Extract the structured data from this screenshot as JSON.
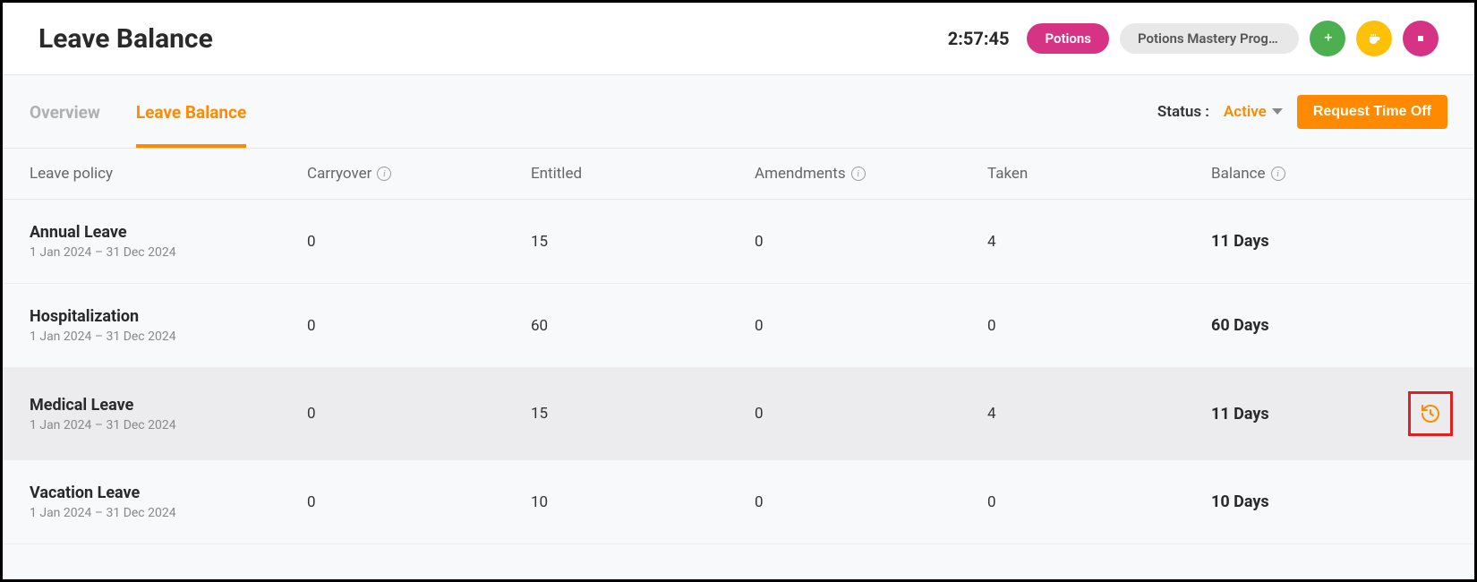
{
  "header": {
    "title": "Leave Balance",
    "timer": "2:57:45",
    "pill_primary": "Potions",
    "pill_secondary": "Potions Mastery Progr…"
  },
  "tabs": {
    "overview": "Overview",
    "leave_balance": "Leave Balance"
  },
  "status": {
    "label": "Status :",
    "value": "Active"
  },
  "buttons": {
    "request_time_off": "Request Time Off"
  },
  "columns": {
    "leave_policy": "Leave policy",
    "carryover": "Carryover",
    "entitled": "Entitled",
    "amendments": "Amendments",
    "taken": "Taken",
    "balance": "Balance"
  },
  "rows": [
    {
      "name": "Annual Leave",
      "dates": "1 Jan 2024 – 31 Dec 2024",
      "carryover": "0",
      "entitled": "15",
      "amendments": "0",
      "taken": "4",
      "balance": "11 Days",
      "highlight": false,
      "show_history": false
    },
    {
      "name": "Hospitalization",
      "dates": "1 Jan 2024 – 31 Dec 2024",
      "carryover": "0",
      "entitled": "60",
      "amendments": "0",
      "taken": "0",
      "balance": "60 Days",
      "highlight": false,
      "show_history": false
    },
    {
      "name": "Medical Leave",
      "dates": "1 Jan 2024 – 31 Dec 2024",
      "carryover": "0",
      "entitled": "15",
      "amendments": "0",
      "taken": "4",
      "balance": "11 Days",
      "highlight": true,
      "show_history": true
    },
    {
      "name": "Vacation Leave",
      "dates": "1 Jan 2024 – 31 Dec 2024",
      "carryover": "0",
      "entitled": "10",
      "amendments": "0",
      "taken": "0",
      "balance": "10 Days",
      "highlight": false,
      "show_history": false
    }
  ]
}
